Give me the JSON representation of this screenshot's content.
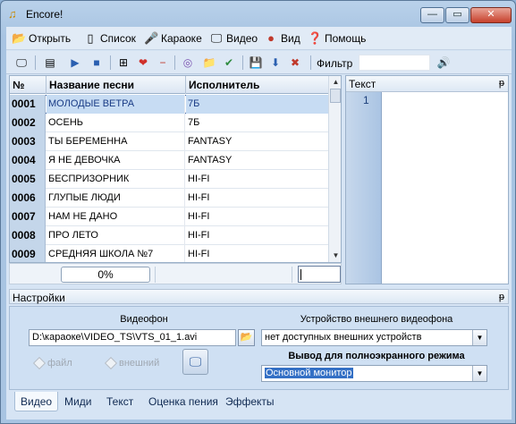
{
  "window": {
    "title": "Encore!",
    "buttons": {
      "minimize": "—",
      "maximize": "▭",
      "close": "✕"
    }
  },
  "menu": [
    {
      "label": "Открыть",
      "icon": "open-folder-icon",
      "glyph": "📂"
    },
    {
      "label": "Список",
      "icon": "list-icon",
      "glyph": "▯"
    },
    {
      "label": "Караоке",
      "icon": "karaoke-icon",
      "glyph": "🎤"
    },
    {
      "label": "Видео",
      "icon": "monitor-icon",
      "glyph": "🖵"
    },
    {
      "label": "Вид",
      "icon": "view-icon",
      "glyph": "●"
    },
    {
      "label": "Помощь",
      "icon": "help-icon",
      "glyph": "❓"
    }
  ],
  "toolbar": {
    "filter_label": "Фильтр",
    "filter_value": "",
    "buttons": [
      {
        "icon": "monitor-icon",
        "glyph": "🖵"
      },
      {
        "icon": "playlist-icon",
        "glyph": "▤"
      },
      {
        "icon": "play-icon",
        "glyph": "▶"
      },
      {
        "icon": "stop-icon",
        "glyph": "■"
      },
      {
        "icon": "add-playlist-icon",
        "glyph": "⊞"
      },
      {
        "icon": "favorite-heart-icon",
        "glyph": "❤"
      },
      {
        "icon": "remove-icon",
        "glyph": "−"
      },
      {
        "icon": "disc-icon",
        "glyph": "◎"
      },
      {
        "icon": "new-folder-icon",
        "glyph": "📁"
      },
      {
        "icon": "check-icon",
        "glyph": "✔"
      },
      {
        "icon": "save-icon",
        "glyph": "💾"
      },
      {
        "icon": "download-icon",
        "glyph": "⬇"
      },
      {
        "icon": "delete-icon",
        "glyph": "✖"
      },
      {
        "icon": "volume-icon",
        "glyph": "🔊"
      }
    ]
  },
  "songs": {
    "columns": {
      "num": "№",
      "name": "Название песни",
      "artist": "Исполнитель"
    },
    "rows": [
      {
        "num": "0001",
        "name": "МОЛОДЫЕ ВЕТРА",
        "artist": "7Б"
      },
      {
        "num": "0002",
        "name": "ОСЕНЬ",
        "artist": "7Б"
      },
      {
        "num": "0003",
        "name": "ТЫ БЕРЕМЕННА",
        "artist": "FANTASY"
      },
      {
        "num": "0004",
        "name": "Я НЕ ДЕВОЧКА",
        "artist": "FANTASY"
      },
      {
        "num": "0005",
        "name": "БЕСПРИЗОРНИК",
        "artist": "HI-FI"
      },
      {
        "num": "0006",
        "name": "ГЛУПЫЕ ЛЮДИ",
        "artist": "HI-FI"
      },
      {
        "num": "0007",
        "name": "НАМ НЕ ДАНО",
        "artist": "HI-FI"
      },
      {
        "num": "0008",
        "name": "ПРО ЛЕТО",
        "artist": "HI-FI"
      },
      {
        "num": "0009",
        "name": "СРЕДНЯЯ ШКОЛА №7",
        "artist": "HI-FI"
      }
    ],
    "progress_label": "0%",
    "progress_fraction": 0
  },
  "text_panel": {
    "title": "Текст",
    "pin": "ᵽ",
    "line_number": "1"
  },
  "settings": {
    "title": "Настройки",
    "pin": "ᵽ",
    "video_bg_label": "Видеофон",
    "video_path": "D:\\караоке\\VIDEO_TS\\VTS_01_1.avi",
    "radio_file": "файл",
    "radio_external": "внешний",
    "external_device_label": "Устройство внешнего видеофона",
    "external_device_value": "нет доступных внешних устройств",
    "fullscreen_label": "Вывод для полноэкранного режима",
    "fullscreen_value": "Основной монитор"
  },
  "tabs": [
    "Видео",
    "Миди",
    "Текст",
    "Оценка пения",
    "Эффекты"
  ]
}
